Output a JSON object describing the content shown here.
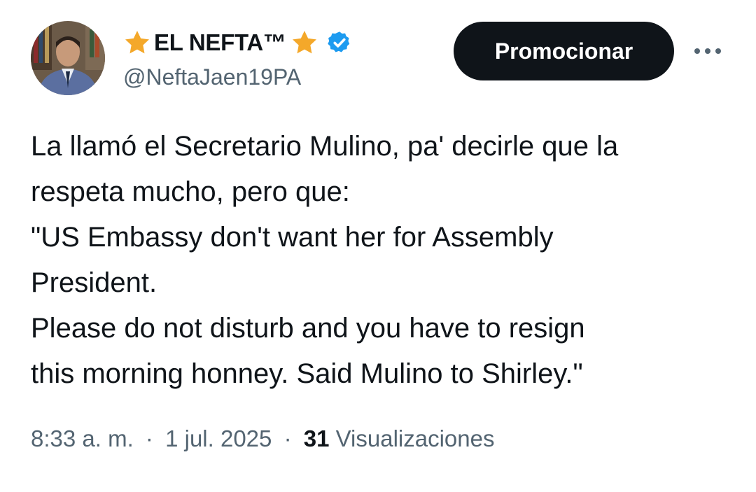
{
  "author": {
    "display_name": "EL NEFTA™",
    "handle": "@NeftaJaen19PA",
    "avatar_icon": "profile-photo",
    "verified_icon": "verified-badge-icon",
    "name_decoration_icon": "star-icon"
  },
  "actions": {
    "promote_label": "Promocionar",
    "more_icon": "more-options-icon"
  },
  "tweet": {
    "lines": [
      "La llamó el Secretario Mulino, pa' decirle que la",
      "respeta mucho, pero que:",
      "\"US Embassy don't want her for Assembly",
      "President.",
      "Please do not disturb and you have to resign",
      "this morning honney. Said Mulino to Shirley.\""
    ]
  },
  "meta": {
    "time": "8:33 a. m.",
    "separator": "·",
    "date": "1 jul. 2025",
    "views_count": "31",
    "views_label": "Visualizaciones"
  },
  "colors": {
    "text": "#0f1419",
    "secondary": "#536471",
    "verified": "#1d9bf0",
    "star": "#f4a82a",
    "button_bg": "#0f1419"
  }
}
